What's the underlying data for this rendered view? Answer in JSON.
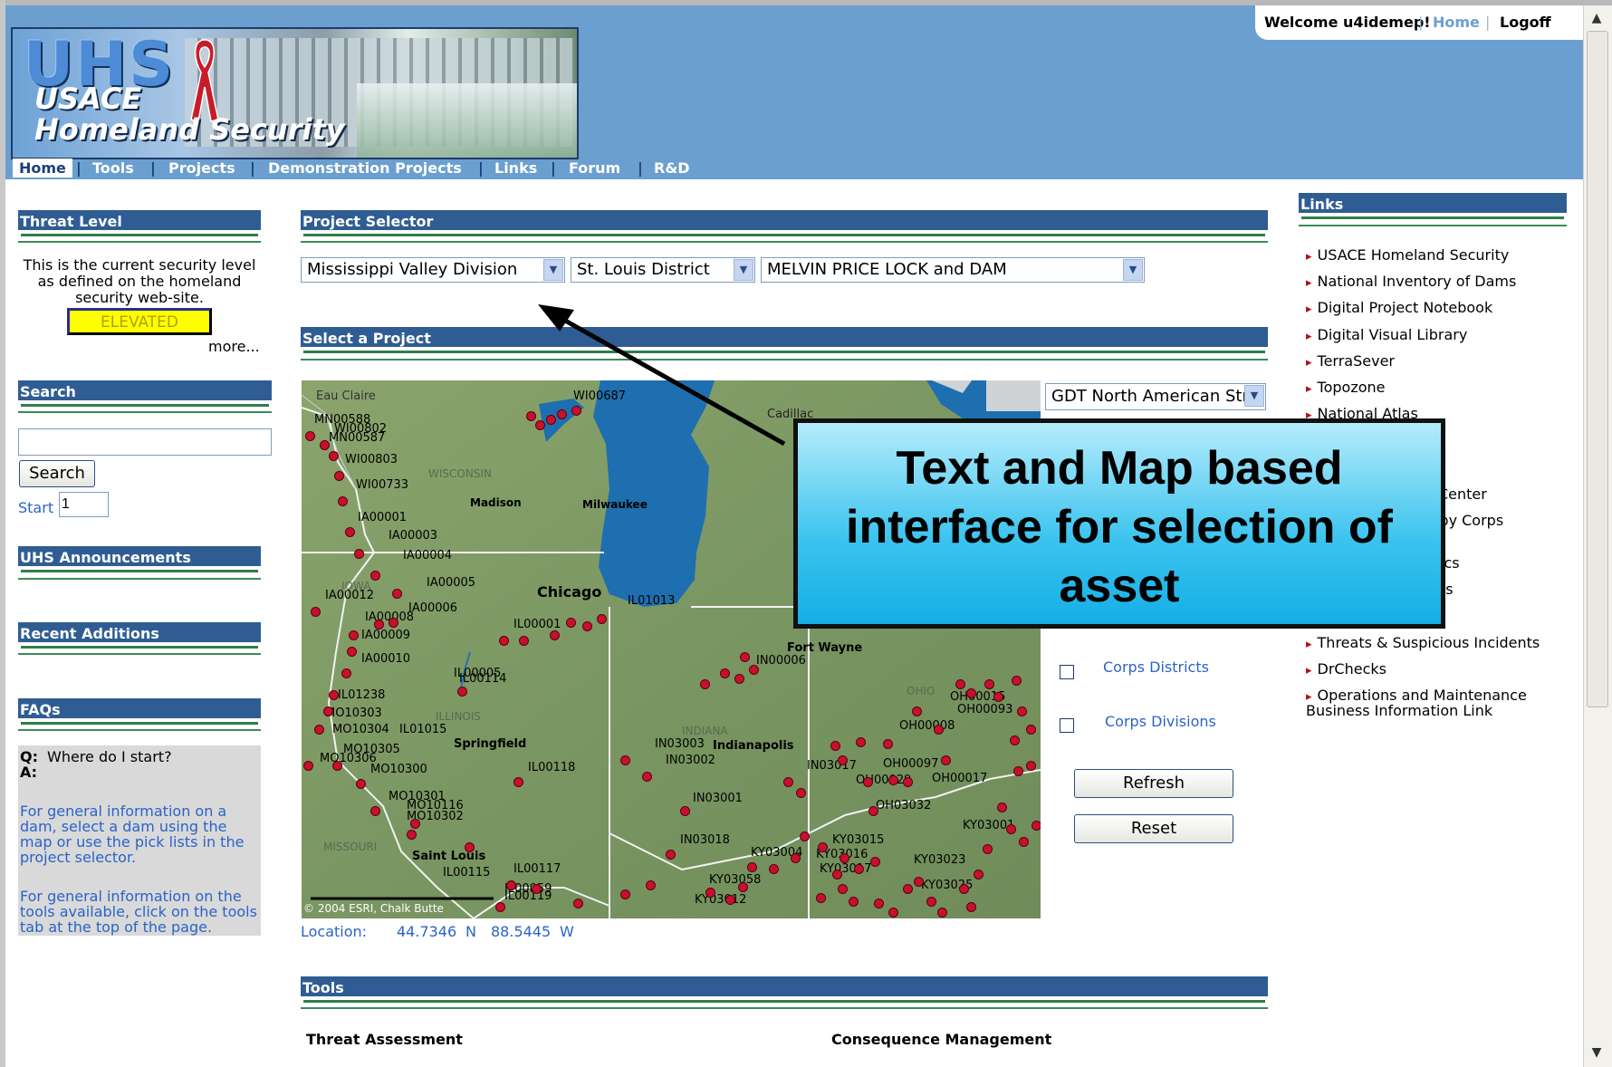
{
  "header": {
    "logo": {
      "abbr": "UHS",
      "line1": "USACE",
      "line2": "Homeland Security"
    },
    "welcome": "Welcome u4idemep!",
    "home_link": "Home",
    "logoff_link": "Logoff",
    "nav": [
      "Home",
      "Tools",
      "Projects",
      "Demonstration Projects",
      "Links",
      "Forum",
      "R&D"
    ]
  },
  "left": {
    "threat_title": "Threat Level",
    "threat_text": [
      "This is the current security level",
      "as defined on the homeland",
      "security web-site."
    ],
    "threat_level": "ELEVATED",
    "more": "more...",
    "search_title": "Search",
    "search_value": "",
    "search_button": "Search",
    "start_label": "Start",
    "start_value": "1",
    "announcements_title": "UHS Announcements",
    "recent_title": "Recent Additions",
    "faqs_title": "FAQs",
    "faq_q_label": "Q:",
    "faq_q": "Where do I start?",
    "faq_a_label": "A:",
    "faq_a1": [
      "For general information on a",
      "dam, select a dam using the",
      "map or use the pick lists in the",
      "project selector."
    ],
    "faq_a2": [
      "For general information on the",
      "tools available, click on the tools",
      "tab at the top of the page."
    ]
  },
  "center": {
    "project_selector_title": "Project Selector",
    "division": "Mississippi Valley Division",
    "district": "St. Louis District",
    "project": "MELVIN PRICE LOCK and DAM",
    "select_project_title": "Select a Project",
    "map_layer": "GDT North American Stre",
    "corps_districts": "Corps Districts",
    "corps_divisions": "Corps Divisions",
    "refresh": "Refresh",
    "reset": "Reset",
    "location_label": "Location:",
    "lat": "44.7346",
    "lat_dir": "N",
    "lon": "88.5445",
    "lon_dir": "W",
    "tools_title": "Tools",
    "tool1": "Threat Assessment",
    "tool2": "Consequence Management"
  },
  "map": {
    "copyright": "© 2004 ESRI, Chalk Butte",
    "cities": [
      "Eau Claire",
      "Madison",
      "Milwaukee",
      "Chicago",
      "Cadillac",
      "Fort Wayne",
      "Indianapolis",
      "Springfield",
      "Saint Louis"
    ],
    "states": [
      "WISCONSIN",
      "IOWA",
      "ILLINOIS",
      "INDIANA",
      "OHIO",
      "MISSOURI"
    ],
    "dam_ids": [
      "MN00588",
      "WI00802",
      "MN00587",
      "WI00803",
      "WI00733",
      "IA00001",
      "IA00003",
      "IA00004",
      "IA00005",
      "IA00012",
      "IA00006",
      "IA00008",
      "IA00009",
      "IA00010",
      "IL01238",
      "MO10303",
      "IL01015",
      "MO10304",
      "MO10305",
      "MO10306",
      "MO10300",
      "MO10301",
      "MO10116",
      "MO10302",
      "IL00118",
      "IL00117",
      "IL00115",
      "IL00059",
      "IL00119",
      "IL01013",
      "IL00001",
      "IL00005",
      "IL00114",
      "IN03003",
      "IN03002",
      "IN03001",
      "IN03018",
      "IN03017",
      "IN00006",
      "OH00008",
      "OH00015",
      "OH00093",
      "OH00097",
      "OH00017",
      "OH00029",
      "OH03032",
      "KY03015",
      "KY03016",
      "KY03017",
      "KY03058",
      "KY03012",
      "KY03004",
      "KY03023",
      "KY03025",
      "KY03001",
      "WI00687"
    ]
  },
  "links": {
    "title": "Links",
    "items": [
      "USACE Homeland Security",
      "National Inventory of Dams",
      "Digital Project Notebook",
      "Digital Visual Library",
      "TerraSever",
      "Topozone",
      "National Atlas",
      "Center",
      "s by Corps",
      "ics",
      "ts",
      "Threats & Suspicious Incidents",
      "DrChecks",
      "Operations and Maintenance"
    ],
    "last_item_line2": "Business Information Link"
  },
  "callout": {
    "lines": [
      "Text and Map based",
      "interface for selection of",
      "asset"
    ]
  },
  "colors": {
    "bar": "#2f5d93",
    "header": "#6b9fcf",
    "accent_green": "#3c8a57",
    "dot": "#c8102e",
    "link_blue": "#2a63c9"
  }
}
